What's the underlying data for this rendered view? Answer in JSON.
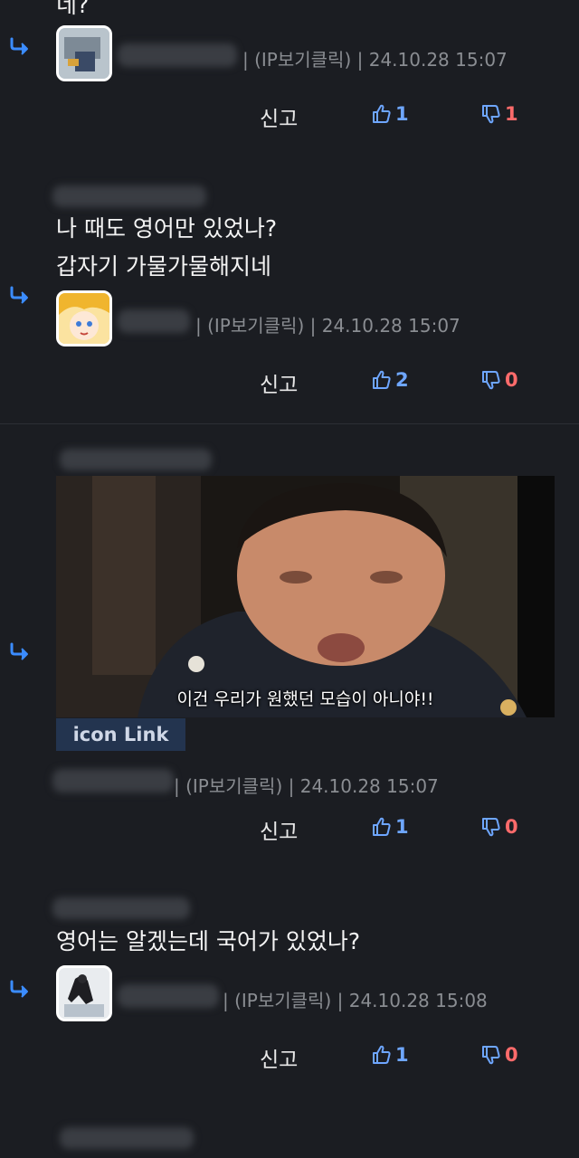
{
  "top_cut_text": "네?",
  "labels": {
    "report": "신고"
  },
  "comments": [
    {
      "meta": "| (IP보기클릭) | 24.10.28 15:07",
      "up": "1",
      "down": "1"
    },
    {
      "text_lines": [
        "나 때도 영어만 있었나?",
        "갑자기 가물가물해지네"
      ],
      "meta": "| (IP보기클릭) | 24.10.28 15:07",
      "up": "2",
      "down": "0"
    },
    {
      "video_subtitle": "이건 우리가 원했던 모습이 아니야!!",
      "link_label": "icon Link",
      "meta": "| (IP보기클릭) | 24.10.28 15:07",
      "up": "1",
      "down": "0"
    },
    {
      "text_lines": [
        "영어는 알겠는데 국어가 있었나?"
      ],
      "meta": "| (IP보기클릭) | 24.10.28 15:08",
      "up": "1",
      "down": "0"
    }
  ],
  "colors": {
    "background": "#1b1d22",
    "upvote": "#6ea6ff",
    "downvote": "#ff6b6b",
    "reply_arrow": "#3b8cff",
    "link_tag_bg": "#23344f"
  },
  "icons": [
    "reply-arrow-icon",
    "thumbs-up-icon",
    "thumbs-down-icon"
  ]
}
